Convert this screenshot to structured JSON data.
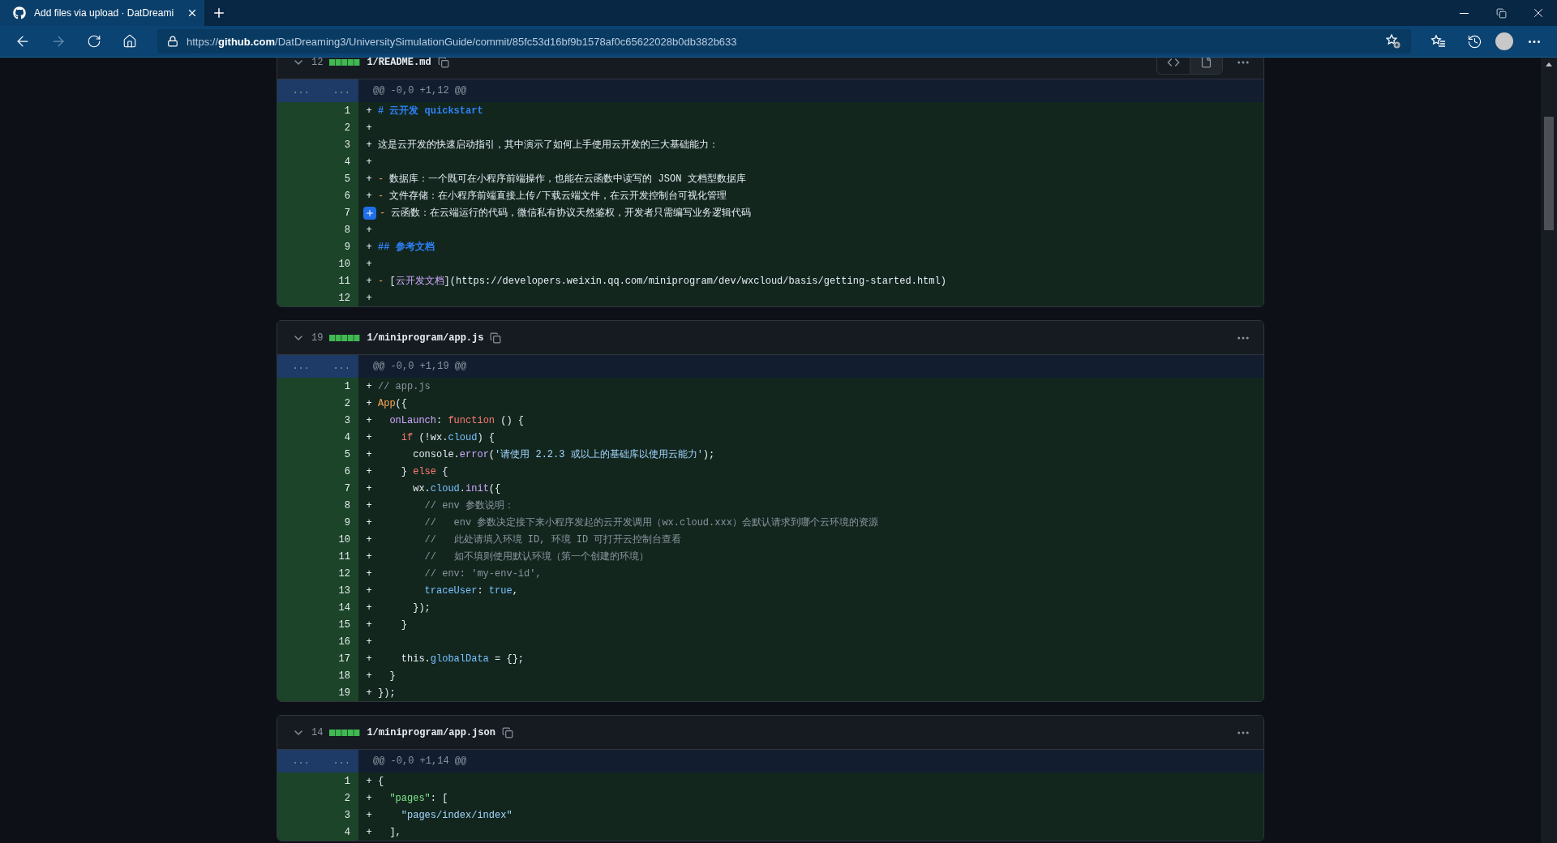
{
  "browser": {
    "tab": {
      "title": "Add files via upload · DatDreami",
      "selected": true
    },
    "address": "https://**github.com**/DatDreaming3/UniversitySimulationGuide/commit/85fc53d16bf9b1578af0c65622028b0db382b633",
    "forward_disabled": true
  },
  "files": [
    {
      "count": "12",
      "path": "1/README.md",
      "view_switch": true,
      "hunk": "@@ -0,0 +1,12 @@",
      "expand": [
        "...",
        "..."
      ],
      "lines": [
        {
          "num": "1",
          "sign": "+",
          "tokens": [
            {
              "kind": "heading",
              "text": "# 云开发 quickstart"
            }
          ]
        },
        {
          "num": "2",
          "sign": "+"
        },
        {
          "num": "3",
          "sign": "+",
          "tokens": [
            {
              "kind": "plain",
              "text": "这是云开发的快速启动指引，其中演示了如何上手使用云开发的三大基础能力："
            }
          ]
        },
        {
          "num": "4",
          "sign": "+"
        },
        {
          "num": "5",
          "sign": "+",
          "tokens": [
            {
              "kind": "entity",
              "text": "-"
            },
            {
              "kind": "plain",
              "text": " 数据库：一个既可在小程序前端操作，也能在云函数中读写的 JSON 文档型数据库"
            }
          ]
        },
        {
          "num": "6",
          "sign": "+",
          "tokens": [
            {
              "kind": "entity",
              "text": "-"
            },
            {
              "kind": "plain",
              "text": " 文件存储：在小程序前端直接上传/下载云端文件，在云开发控制台可视化管理"
            }
          ]
        },
        {
          "num": "7",
          "comment_button": true,
          "tokens": [
            {
              "kind": "entity",
              "text": "-"
            },
            {
              "kind": "plain",
              "text": " 云函数：在云端运行的代码，微信私有协议天然鉴权，开发者只需编写业务逻辑代码"
            }
          ]
        },
        {
          "num": "8",
          "sign": "+"
        },
        {
          "num": "9",
          "sign": "+",
          "tokens": [
            {
              "kind": "heading",
              "text": "## 参考文档"
            }
          ]
        },
        {
          "num": "10",
          "sign": "+"
        },
        {
          "num": "11",
          "sign": "+",
          "tokens": [
            {
              "kind": "entity",
              "text": "-"
            },
            {
              "kind": "plain",
              "text": " ["
            },
            {
              "kind": "link",
              "text": "云开发文档"
            },
            {
              "kind": "plain",
              "text": "](https://developers.weixin.qq.com/miniprogram/dev/wxcloud/basis/getting-started.html)"
            }
          ]
        },
        {
          "num": "12",
          "sign": "+"
        }
      ]
    },
    {
      "count": "19",
      "path": "1/miniprogram/app.js",
      "view_switch": false,
      "hunk": "@@ -0,0 +1,19 @@",
      "expand": [
        "...",
        "..."
      ],
      "lines": [
        {
          "num": "1",
          "sign": "+",
          "tokens": [
            {
              "kind": "comment",
              "text": "// app.js"
            }
          ]
        },
        {
          "num": "2",
          "sign": "+",
          "tokens": [
            {
              "kind": "entity",
              "text": "App"
            },
            {
              "kind": "plain",
              "text": "({"
            }
          ]
        },
        {
          "num": "3",
          "sign": "+",
          "tokens": [
            {
              "kind": "func",
              "text": "  onLaunch"
            },
            {
              "kind": "plain",
              "text": ": "
            },
            {
              "kind": "keyword",
              "text": "function"
            },
            {
              "kind": "plain",
              "text": " () {"
            }
          ]
        },
        {
          "num": "4",
          "sign": "+",
          "tokens": [
            {
              "kind": "keyword",
              "text": "    if"
            },
            {
              "kind": "plain",
              "text": " (!wx."
            },
            {
              "kind": "const",
              "text": "cloud"
            },
            {
              "kind": "plain",
              "text": ") {"
            }
          ]
        },
        {
          "num": "5",
          "sign": "+",
          "tokens": [
            {
              "kind": "plain",
              "text": "      console."
            },
            {
              "kind": "func",
              "text": "error"
            },
            {
              "kind": "plain",
              "text": "("
            },
            {
              "kind": "string",
              "text": "'请使用 2.2.3 或以上的基础库以使用云能力'"
            },
            {
              "kind": "plain",
              "text": ");"
            }
          ]
        },
        {
          "num": "6",
          "sign": "+",
          "tokens": [
            {
              "kind": "plain",
              "text": "    } "
            },
            {
              "kind": "keyword",
              "text": "else"
            },
            {
              "kind": "plain",
              "text": " {"
            }
          ]
        },
        {
          "num": "7",
          "sign": "+",
          "tokens": [
            {
              "kind": "plain",
              "text": "      wx."
            },
            {
              "kind": "const",
              "text": "cloud"
            },
            {
              "kind": "plain",
              "text": "."
            },
            {
              "kind": "func",
              "text": "init"
            },
            {
              "kind": "plain",
              "text": "({"
            }
          ]
        },
        {
          "num": "8",
          "sign": "+",
          "tokens": [
            {
              "kind": "comment",
              "text": "        // env 参数说明："
            }
          ]
        },
        {
          "num": "9",
          "sign": "+",
          "tokens": [
            {
              "kind": "comment",
              "text": "        //   env 参数决定接下来小程序发起的云开发调用（wx.cloud.xxx）会默认请求到哪个云环境的资源"
            }
          ]
        },
        {
          "num": "10",
          "sign": "+",
          "tokens": [
            {
              "kind": "comment",
              "text": "        //   此处请填入环境 ID, 环境 ID 可打开云控制台查看"
            }
          ]
        },
        {
          "num": "11",
          "sign": "+",
          "tokens": [
            {
              "kind": "comment",
              "text": "        //   如不填则使用默认环境（第一个创建的环境）"
            }
          ]
        },
        {
          "num": "12",
          "sign": "+",
          "tokens": [
            {
              "kind": "comment",
              "text": "        // env: 'my-env-id',"
            }
          ]
        },
        {
          "num": "13",
          "sign": "+",
          "tokens": [
            {
              "kind": "const",
              "text": "        traceUser"
            },
            {
              "kind": "plain",
              "text": ": "
            },
            {
              "kind": "const",
              "text": "true"
            },
            {
              "kind": "plain",
              "text": ","
            }
          ]
        },
        {
          "num": "14",
          "sign": "+",
          "tokens": [
            {
              "kind": "plain",
              "text": "      });"
            }
          ]
        },
        {
          "num": "15",
          "sign": "+",
          "tokens": [
            {
              "kind": "plain",
              "text": "    }"
            }
          ]
        },
        {
          "num": "16",
          "sign": "+"
        },
        {
          "num": "17",
          "sign": "+",
          "tokens": [
            {
              "kind": "plain",
              "text": "    this."
            },
            {
              "kind": "const",
              "text": "globalData"
            },
            {
              "kind": "plain",
              "text": " = {};"
            }
          ]
        },
        {
          "num": "18",
          "sign": "+",
          "tokens": [
            {
              "kind": "plain",
              "text": "  }"
            }
          ]
        },
        {
          "num": "19",
          "sign": "+",
          "tokens": [
            {
              "kind": "plain",
              "text": "});"
            }
          ]
        }
      ]
    },
    {
      "count": "14",
      "path": "1/miniprogram/app.json",
      "view_switch": false,
      "hunk": "@@ -0,0 +1,14 @@",
      "expand": [
        "...",
        "..."
      ],
      "lines": [
        {
          "num": "1",
          "sign": "+",
          "tokens": [
            {
              "kind": "plain",
              "text": "{"
            }
          ]
        },
        {
          "num": "2",
          "sign": "+",
          "tokens": [
            {
              "kind": "key",
              "text": "  \"pages\""
            },
            {
              "kind": "plain",
              "text": ": ["
            }
          ]
        },
        {
          "num": "3",
          "sign": "+",
          "tokens": [
            {
              "kind": "string",
              "text": "    \"pages/index/index\""
            }
          ]
        },
        {
          "num": "4",
          "sign": "+",
          "tokens": [
            {
              "kind": "plain",
              "text": "  ],"
            }
          ]
        }
      ]
    }
  ]
}
